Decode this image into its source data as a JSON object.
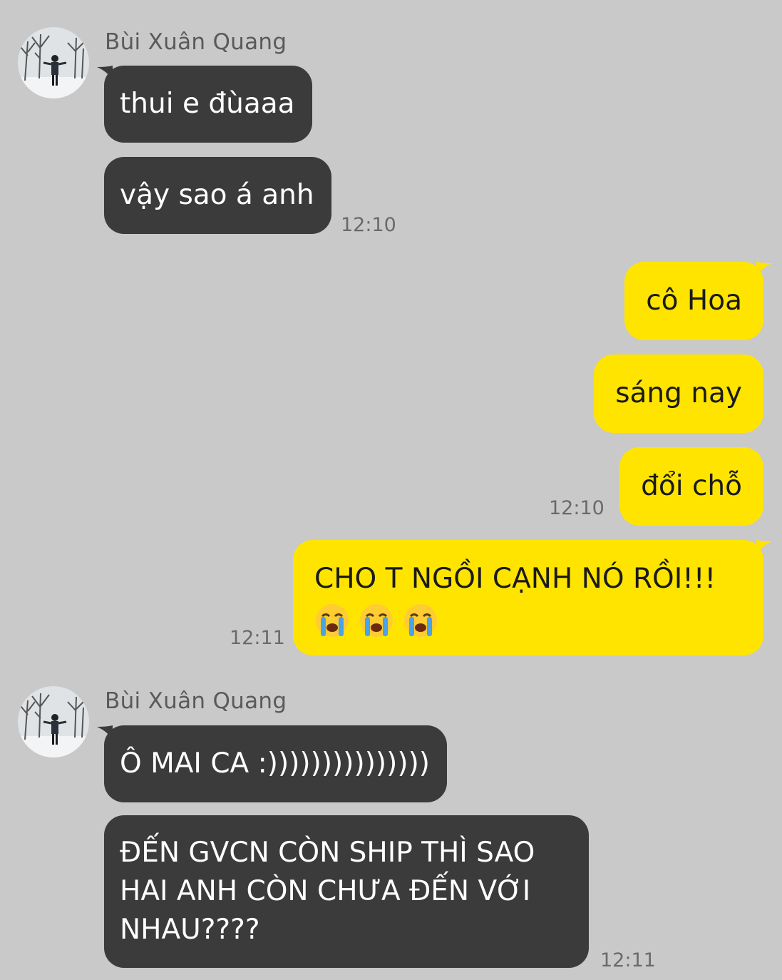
{
  "colors": {
    "background": "#c9c9c9",
    "incoming_bubble": "#3b3b3b",
    "outgoing_bubble": "#ffe400"
  },
  "group1": {
    "sender": "Bùi Xuân Quang",
    "messages": [
      "thui e đùaaa",
      "vậy sao á anh"
    ],
    "time": "12:10"
  },
  "group2": {
    "messages": [
      "cô Hoa",
      "sáng nay",
      "đổi chỗ"
    ],
    "time": "12:10"
  },
  "group3": {
    "message": "CHO T NGỒI CẠNH NÓ RỒI!!!",
    "emoji_icon": "loudly-crying-face",
    "emoji_count": 3,
    "time": "12:11"
  },
  "group4": {
    "sender": "Bùi Xuân Quang",
    "messages": [
      "Ô MAI CA :)))))))))))))))",
      "ĐẾN GVCN CÒN SHIP THÌ SAO HAI ANH CÒN CHƯA ĐẾN VỚI NHAU????"
    ],
    "time": "12:11"
  }
}
